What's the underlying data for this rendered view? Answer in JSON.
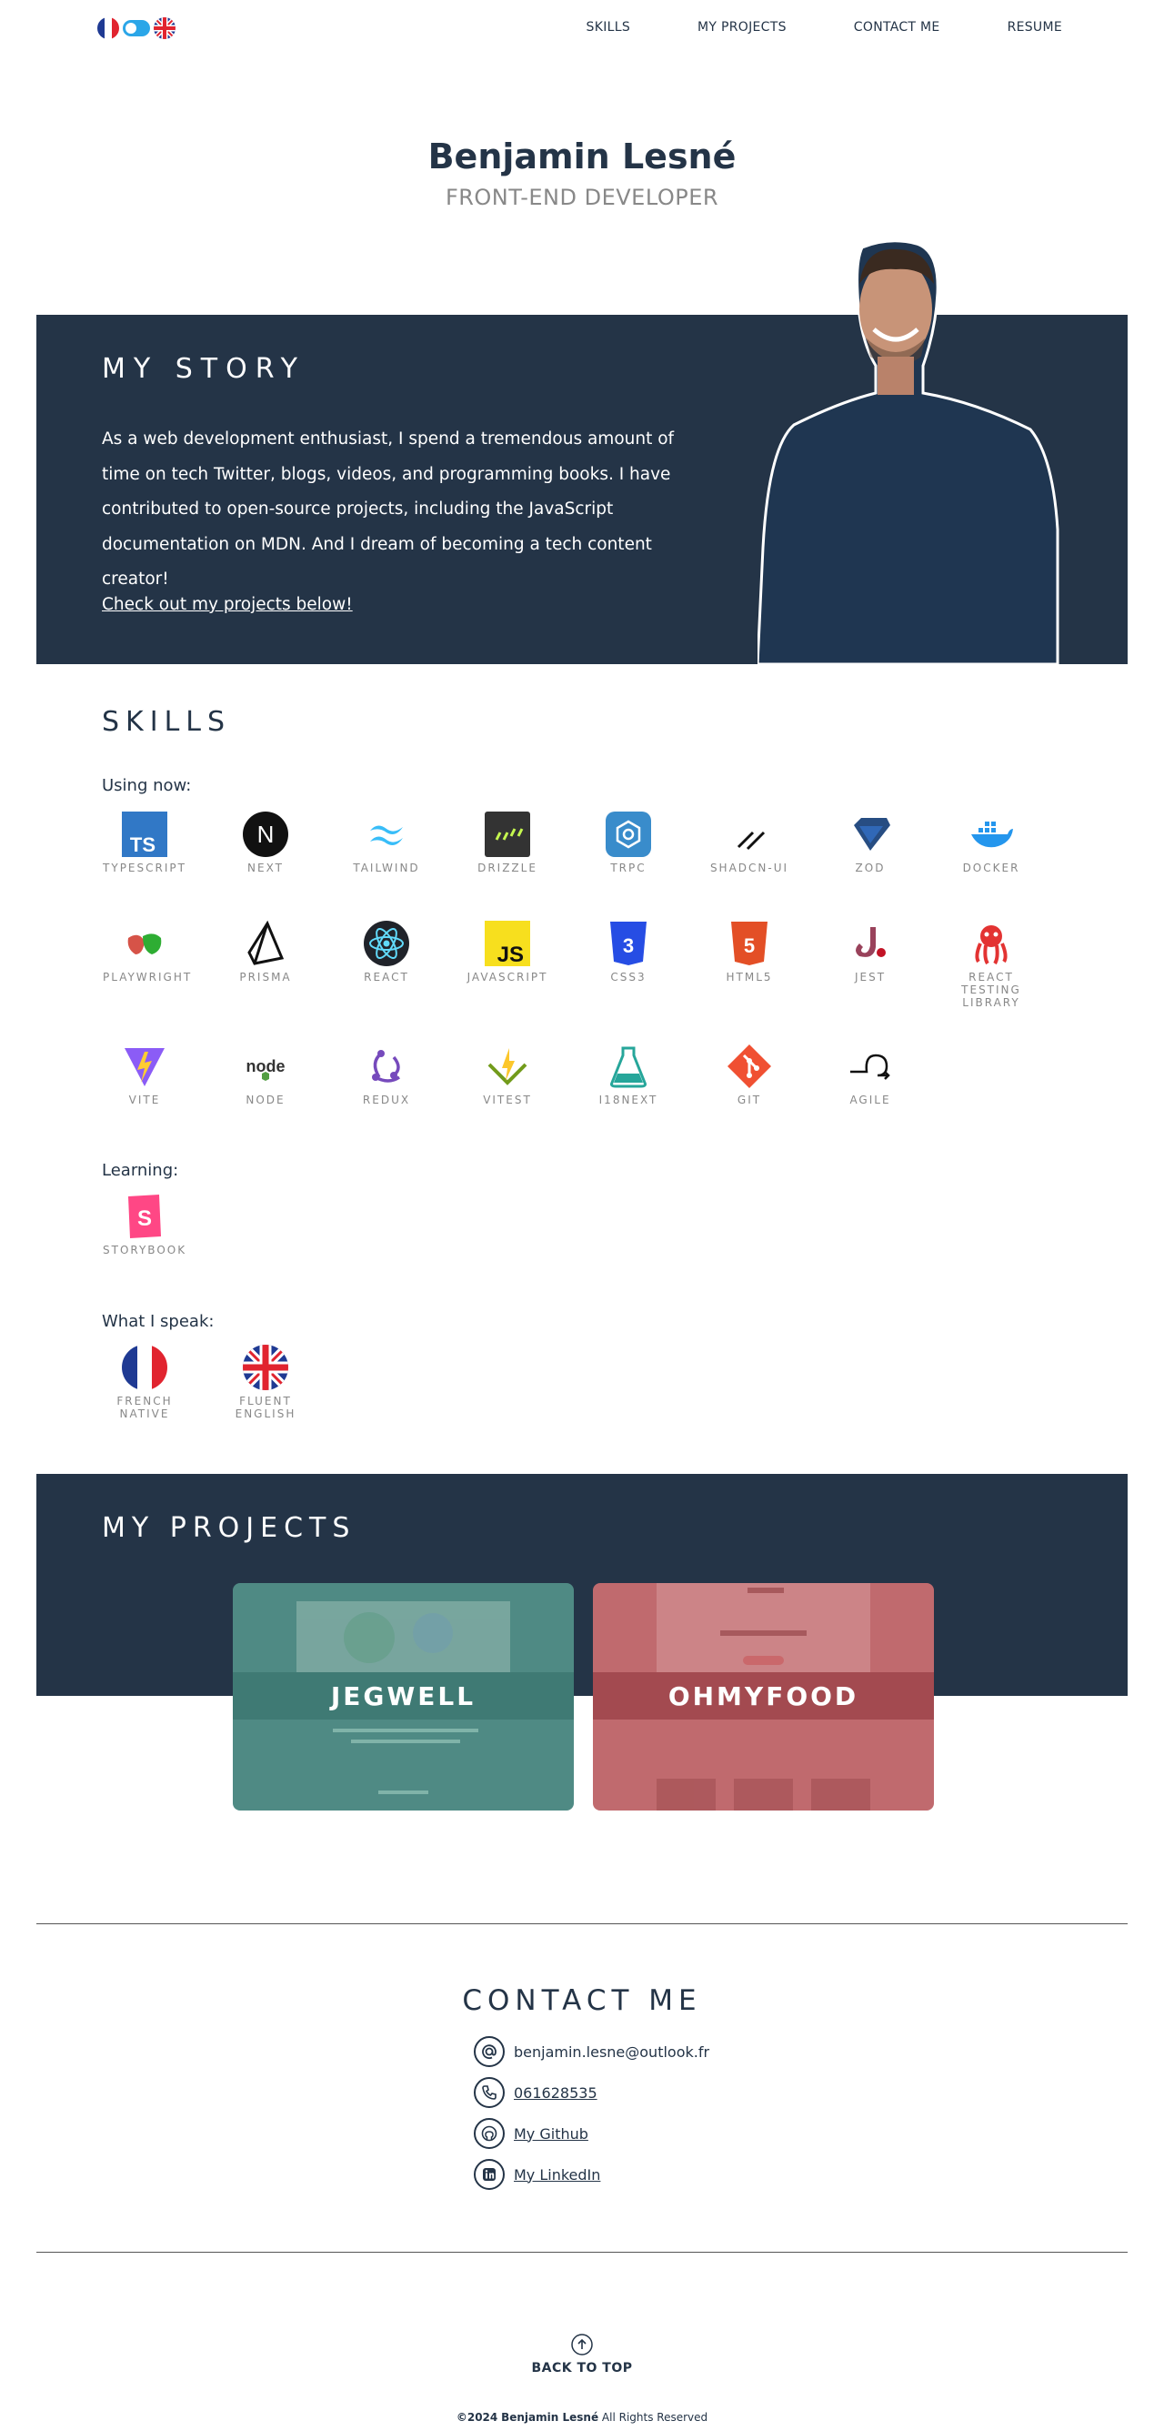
{
  "nav": {
    "links": [
      "SKILLS",
      "MY PROJECTS",
      "CONTACT ME",
      "RESUME"
    ]
  },
  "hero": {
    "name": "Benjamin Lesné",
    "role": "FRONT-END DEVELOPER"
  },
  "story": {
    "title": "MY STORY",
    "text": "As a web development enthusiast, I spend a tremendous amount of time on tech Twitter, blogs, videos, and programming books. I have contributed to open-source projects, including the JavaScript documentation on MDN. And I dream of becoming a tech content creator!",
    "link": "Check out my projects below!"
  },
  "skills": {
    "title": "SKILLS",
    "using_label": "Using now:",
    "using": [
      {
        "label": "TYPESCRIPT",
        "icon": "typescript-icon"
      },
      {
        "label": "NEXT",
        "icon": "nextjs-icon"
      },
      {
        "label": "TAILWIND",
        "icon": "tailwind-icon"
      },
      {
        "label": "DRIZZLE",
        "icon": "drizzle-icon"
      },
      {
        "label": "TRPC",
        "icon": "trpc-icon"
      },
      {
        "label": "SHADCN-UI",
        "icon": "shadcn-icon"
      },
      {
        "label": "ZOD",
        "icon": "zod-icon"
      },
      {
        "label": "DOCKER",
        "icon": "docker-icon"
      },
      {
        "label": "PLAYWRIGHT",
        "icon": "playwright-icon"
      },
      {
        "label": "PRISMA",
        "icon": "prisma-icon"
      },
      {
        "label": "REACT",
        "icon": "react-icon"
      },
      {
        "label": "JAVASCRIPT",
        "icon": "javascript-icon"
      },
      {
        "label": "CSS3",
        "icon": "css3-icon"
      },
      {
        "label": "HTML5",
        "icon": "html5-icon"
      },
      {
        "label": "JEST",
        "icon": "jest-icon"
      },
      {
        "label": "REACT TESTING LIBRARY",
        "icon": "testing-library-icon"
      },
      {
        "label": "VITE",
        "icon": "vite-icon"
      },
      {
        "label": "NODE",
        "icon": "node-icon"
      },
      {
        "label": "REDUX",
        "icon": "redux-icon"
      },
      {
        "label": "VITEST",
        "icon": "vitest-icon"
      },
      {
        "label": "I18NEXT",
        "icon": "i18next-icon"
      },
      {
        "label": "GIT",
        "icon": "git-icon"
      },
      {
        "label": "AGILE",
        "icon": "agile-icon"
      }
    ],
    "learning_label": "Learning:",
    "learning": [
      {
        "label": "STORYBOOK",
        "icon": "storybook-icon"
      }
    ],
    "speak_label": "What I speak:",
    "speak": [
      {
        "label": "FRENCH NATIVE",
        "icon": "french-flag-icon"
      },
      {
        "label": "FLUENT ENGLISH",
        "icon": "uk-flag-icon"
      }
    ]
  },
  "projects": {
    "title": "MY PROJECTS",
    "items": [
      {
        "name": "JEGWELL",
        "color": "#4f8a84"
      },
      {
        "name": "OHMYFOOD",
        "color": "#b05a5e"
      }
    ]
  },
  "contact": {
    "title": "CONTACT ME",
    "email": "benjamin.lesne@outlook.fr",
    "phone": "061628535",
    "github": "My Github",
    "linkedin": "My LinkedIn"
  },
  "footer": {
    "back_to_top": "BACK TO TOP",
    "copyright_year": "©2024",
    "copyright_name": "Benjamin Lesné",
    "copyright_rest": "All Rights Reserved"
  },
  "colors": {
    "navy": "#243447",
    "muted": "#888888"
  }
}
